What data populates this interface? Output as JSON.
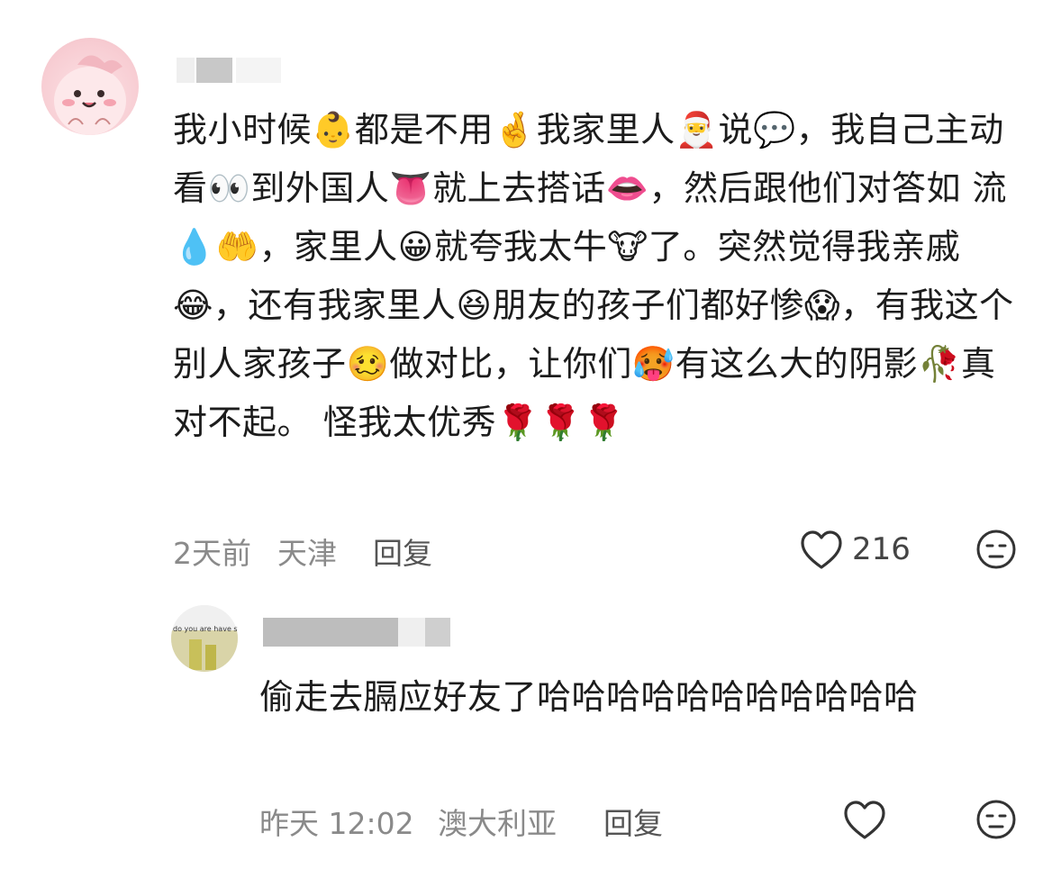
{
  "comment": {
    "text": "我小时候👶都是不用🤞我家里人🎅说💬，我自己主动看👀到外国人👅就上去搭话👄，然后跟他们对答如 流💧🤲，家里人😀就夸我太牛🐮了。突然觉得我亲戚😂，还有我家里人😆朋友的孩子们都好惨😱，有我这个别人家孩子🥴做对比，让你们🥵有这么大的阴影🥀真对不起。 怪我太优秀🌹🌹🌹",
    "time": "2天前",
    "location": "天津",
    "reply_label": "回复",
    "like_count": "216"
  },
  "reply": {
    "avatar_caption": "do you are have stupid",
    "text": "偷走去膈应好友了哈哈哈哈哈哈哈哈哈哈哈",
    "time": "昨天 12:02",
    "location": "澳大利亚",
    "reply_label": "回复"
  },
  "icons": {
    "like": "heart-outline-icon",
    "dislike": "neutral-face-outline-icon"
  }
}
